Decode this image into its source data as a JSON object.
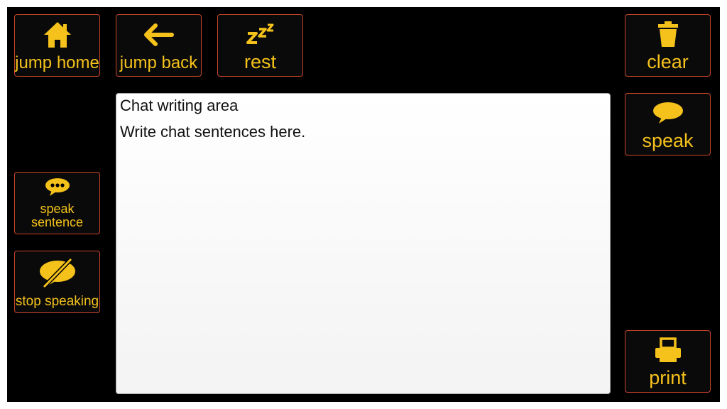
{
  "colors": {
    "background": "#000000",
    "accent": "#f5c21b",
    "button_border": "#c8452a",
    "chat_bg": "#ffffff"
  },
  "toolbar": {
    "jump_home": {
      "label": "jump home",
      "icon": "home-icon"
    },
    "jump_back": {
      "label": "jump back",
      "icon": "arrow-left-icon"
    },
    "rest": {
      "label": "rest",
      "icon": "sleep-zzz-icon"
    },
    "clear": {
      "label": "clear",
      "icon": "trash-icon"
    },
    "speak": {
      "label": "speak",
      "icon": "speech-bubble-icon"
    },
    "speak_sentence": {
      "label_line1": "speak",
      "label_line2": "sentence",
      "icon": "speech-bubble-dots-icon"
    },
    "stop_speaking": {
      "label": "stop speaking",
      "icon": "speech-bubble-slash-icon"
    },
    "print": {
      "label": "print",
      "icon": "printer-icon"
    }
  },
  "chat": {
    "title": "Chat writing area",
    "text": "Write chat sentences here."
  }
}
